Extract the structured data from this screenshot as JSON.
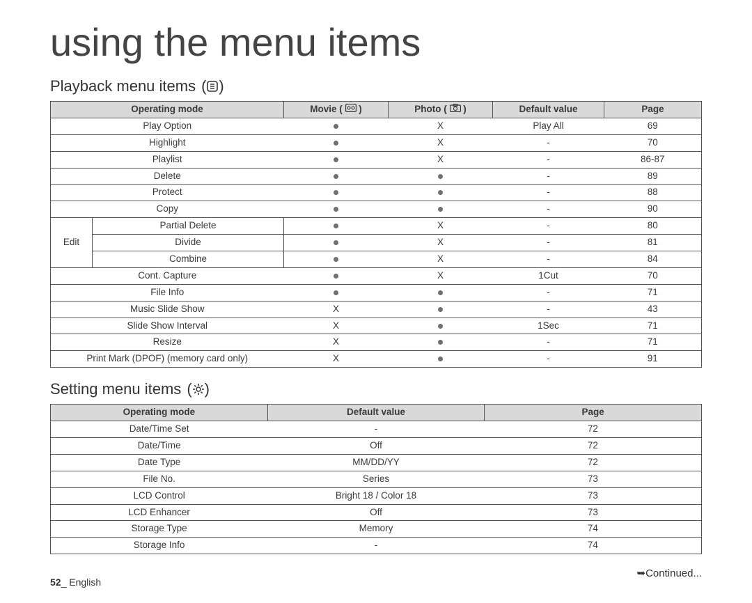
{
  "title": "using the menu items",
  "section1": {
    "title": "Playback menu items",
    "icon": "playback-icon",
    "headers": {
      "op": "Operating mode",
      "movie": "Movie",
      "photo": "Photo",
      "default": "Default value",
      "page": "Page"
    },
    "rows": [
      {
        "name": "Play Option",
        "movie": "●",
        "photo": "X",
        "default": "Play All",
        "page": "69"
      },
      {
        "name": "Highlight",
        "movie": "●",
        "photo": "X",
        "default": "-",
        "page": "70"
      },
      {
        "name": "Playlist",
        "movie": "●",
        "photo": "X",
        "default": "-",
        "page": "86-87"
      },
      {
        "name": "Delete",
        "movie": "●",
        "photo": "●",
        "default": "-",
        "page": "89"
      },
      {
        "name": "Protect",
        "movie": "●",
        "photo": "●",
        "default": "-",
        "page": "88"
      },
      {
        "name": "Copy",
        "movie": "●",
        "photo": "●",
        "default": "-",
        "page": "90"
      },
      {
        "name": "Partial Delete",
        "movie": "●",
        "photo": "X",
        "default": "-",
        "page": "80",
        "edit": true
      },
      {
        "name": "Divide",
        "movie": "●",
        "photo": "X",
        "default": "-",
        "page": "81",
        "edit": true
      },
      {
        "name": "Combine",
        "movie": "●",
        "photo": "X",
        "default": "-",
        "page": "84",
        "edit": true
      },
      {
        "name": "Cont. Capture",
        "movie": "●",
        "photo": "X",
        "default": "1Cut",
        "page": "70"
      },
      {
        "name": "File Info",
        "movie": "●",
        "photo": "●",
        "default": "-",
        "page": "71"
      },
      {
        "name": "Music Slide Show",
        "movie": "X",
        "photo": "●",
        "default": "-",
        "page": "43"
      },
      {
        "name": "Slide Show Interval",
        "movie": "X",
        "photo": "●",
        "default": "1Sec",
        "page": "71"
      },
      {
        "name": "Resize",
        "movie": "X",
        "photo": "●",
        "default": "-",
        "page": "71"
      },
      {
        "name": "Print Mark (DPOF) (memory card only)",
        "movie": "X",
        "photo": "●",
        "default": "-",
        "page": "91"
      }
    ],
    "editLabel": "Edit"
  },
  "section2": {
    "title": "Setting menu items",
    "icon": "settings-icon",
    "headers": {
      "op": "Operating mode",
      "default": "Default value",
      "page": "Page"
    },
    "rows": [
      {
        "name": "Date/Time Set",
        "default": "-",
        "page": "72"
      },
      {
        "name": "Date/Time",
        "default": "Off",
        "page": "72"
      },
      {
        "name": "Date Type",
        "default": "MM/DD/YY",
        "page": "72"
      },
      {
        "name": "File No.",
        "default": "Series",
        "page": "73"
      },
      {
        "name": "LCD Control",
        "default": "Bright 18 / Color 18",
        "page": "73"
      },
      {
        "name": "LCD Enhancer",
        "default": "Off",
        "page": "73"
      },
      {
        "name": "Storage Type",
        "default": "Memory",
        "page": "74"
      },
      {
        "name": "Storage Info",
        "default": "-",
        "page": "74"
      }
    ]
  },
  "continued": "➥Continued...",
  "footer": {
    "page": "52",
    "sep": "_",
    "lang": "English"
  }
}
